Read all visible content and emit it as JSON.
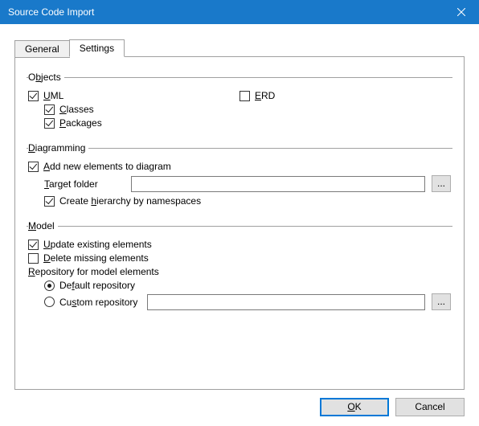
{
  "window": {
    "title": "Source Code Import"
  },
  "tabs": {
    "general": "General",
    "settings": "Settings"
  },
  "objects": {
    "legend_pre": "O",
    "legend_u": "b",
    "legend_post": "jects",
    "uml_u": "U",
    "uml_post": "ML",
    "erd_u": "E",
    "erd_post": "RD",
    "classes_u": "C",
    "classes_post": "lasses",
    "packages_u": "P",
    "packages_post": "ackages"
  },
  "diagramming": {
    "legend_u": "D",
    "legend_post": "iagramming",
    "add_u": "A",
    "add_post": "dd new elements to diagram",
    "target_u": "T",
    "target_post": "arget folder",
    "target_value": "",
    "hier_pre": "Create ",
    "hier_u": "h",
    "hier_post": "ierarchy by namespaces",
    "browse": "..."
  },
  "model": {
    "legend_u": "M",
    "legend_post": "odel",
    "update_u": "U",
    "update_post": "pdate existing elements",
    "delete_u": "D",
    "delete_post": "elete missing elements",
    "repo_u": "R",
    "repo_post": "epository for model elements",
    "default_pre": "De",
    "default_u": "f",
    "default_post": "ault repository",
    "custom_pre": "Cu",
    "custom_u": "s",
    "custom_post": "tom repository",
    "custom_value": "",
    "browse": "..."
  },
  "buttons": {
    "ok_u": "O",
    "ok_post": "K",
    "cancel": "Cancel"
  }
}
